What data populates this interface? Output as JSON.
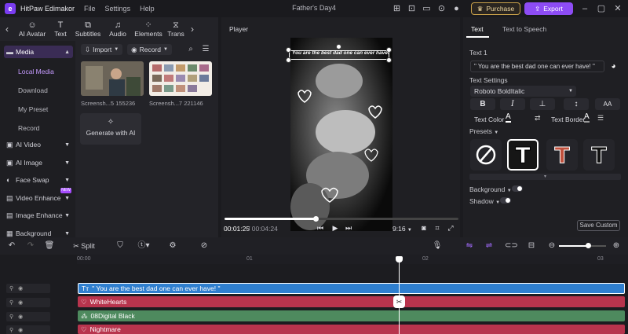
{
  "app": {
    "name": "HitPaw Edimakor",
    "menu": [
      "File",
      "Settings",
      "Help"
    ],
    "doc_title": "Father's Day4",
    "purchase_label": "Purchase",
    "export_label": "Export"
  },
  "toolbar": {
    "tools": [
      {
        "label": "AI Avatar",
        "icon": "avatar-icon",
        "glyph": "☺"
      },
      {
        "label": "Text",
        "icon": "text-icon",
        "glyph": "T"
      },
      {
        "label": "Subtitles",
        "icon": "subtitles-icon",
        "glyph": "⧉"
      },
      {
        "label": "Audio",
        "icon": "audio-icon",
        "glyph": "♫"
      },
      {
        "label": "Elements",
        "icon": "elements-icon",
        "glyph": "⁘"
      },
      {
        "label": "Trans",
        "icon": "transition-icon",
        "glyph": "⧖"
      }
    ]
  },
  "leftnav": {
    "media_label": "Media",
    "sub_items": [
      "Local Media",
      "Download",
      "My Preset",
      "Record"
    ],
    "items": [
      "AI Video",
      "AI Image",
      "Face Swap",
      "Video Enhance",
      "Image Enhance",
      "Background"
    ],
    "new_badge": "NEW"
  },
  "media": {
    "import_label": "Import",
    "record_label": "Record",
    "thumbs": [
      "Screensh...5 155236",
      "Screensh...7 221146"
    ],
    "generate_label": "Generate with AI"
  },
  "player": {
    "title": "Player",
    "overlay_text": "You are the best dad one can ever have!",
    "current_time": "00:01:25",
    "total_time": "/ 00:04:24",
    "ratio": "9:16",
    "progress": 0.39
  },
  "right_panel": {
    "tabs": [
      "Text",
      "Text to Speech"
    ],
    "text_section": "Text 1",
    "text_value": "\" You are the best dad one can ever have! \"",
    "settings_label": "Text Settings",
    "font": "Roboto BoldItalic",
    "fmt_buttons": [
      "B",
      "I",
      "⊥",
      "↕",
      "AA"
    ],
    "text_color_label": "Text Color",
    "text_border_label": "Text Border",
    "presets_label": "Presets",
    "background_label": "Background",
    "shadow_label": "Shadow",
    "save_label": "Save Custom"
  },
  "timeline": {
    "split_label": "Split",
    "ticks": [
      "00:00",
      "01",
      "02",
      "03"
    ],
    "clips": [
      {
        "label": "\" You are the best dad one can ever have! \"",
        "color": "#2f7fcf"
      },
      {
        "label": "WhiteHearts",
        "color": "#b8344d"
      },
      {
        "label": "08Digital Black",
        "color": "#4e8a5e"
      },
      {
        "label": "Nightmare",
        "color": "#b8344d"
      }
    ],
    "zoom": 0.62
  },
  "colors": {
    "accent": "#8d4cf5",
    "gold": "#c9a14a"
  }
}
